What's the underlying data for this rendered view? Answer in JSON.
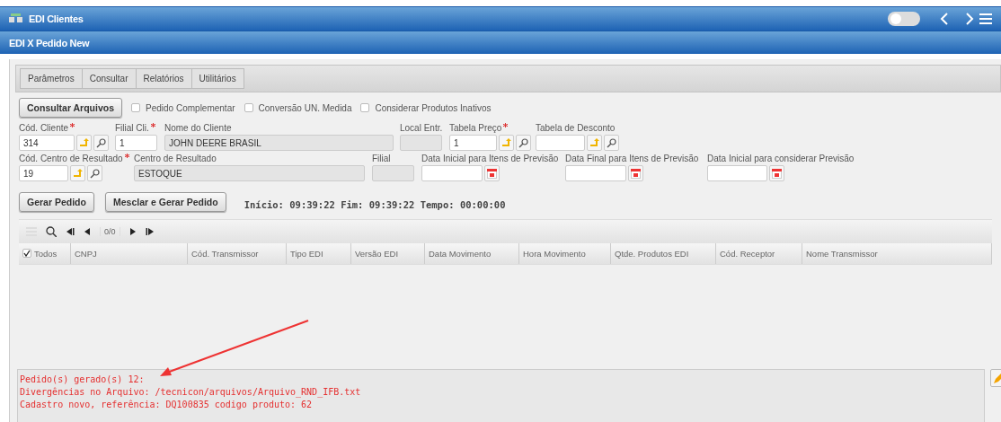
{
  "window": {
    "title": "EDI Clientes",
    "toggle_on": false
  },
  "subtitle": "EDI X Pedido New",
  "tabs": [
    {
      "label": "Parâmetros",
      "selected": false
    },
    {
      "label": "Consultar",
      "selected": false
    },
    {
      "label": "Relatórios",
      "selected": false
    },
    {
      "label": "Utilitários",
      "selected": false
    }
  ],
  "consult_button": "Consultar Arquivos",
  "options": [
    {
      "label": "Pedido Complementar",
      "checked": false
    },
    {
      "label": "Conversão UN. Medida",
      "checked": false
    },
    {
      "label": "Considerar Produtos Inativos",
      "checked": false
    }
  ],
  "field_rows": [
    [
      {
        "label": "Cód. Cliente",
        "required": true,
        "value": "314",
        "kind": "lookup",
        "readonly": false
      },
      {
        "label": "Filial Cli.",
        "required": true,
        "value": "1",
        "kind": "text",
        "readonly": false
      },
      {
        "label": "Nome do Cliente",
        "required": false,
        "value": "JOHN DEERE BRASIL",
        "kind": "text",
        "readonly": true
      },
      {
        "label": "Local Entr.",
        "required": false,
        "kind": "text",
        "readonly": true
      },
      {
        "label": "Tabela Preço",
        "required": true,
        "value": "1",
        "kind": "lookup",
        "readonly": false
      },
      {
        "label": "Tabela de Desconto",
        "required": false,
        "kind": "lookup",
        "readonly": false
      }
    ],
    [
      {
        "label": "Cód. Centro de Resultado",
        "required": true,
        "value": "19",
        "kind": "lookup",
        "readonly": false
      },
      {
        "label": "Centro de Resultado",
        "required": false,
        "value": "ESTOQUE",
        "kind": "text",
        "readonly": true
      },
      {
        "label": "Filial",
        "required": false,
        "kind": "text",
        "readonly": true
      },
      {
        "label": "Data Inicial para Itens de Previsão",
        "required": false,
        "kind": "date",
        "readonly": false
      },
      {
        "label": "Data Final para Itens de Previsão",
        "required": false,
        "kind": "date",
        "readonly": false
      },
      {
        "label": "Data Inicial para considerar Previsão",
        "required": false,
        "kind": "date",
        "readonly": false
      }
    ]
  ],
  "action_buttons": [
    "Gerar Pedido",
    "Mesclar e Gerar Pedido"
  ],
  "timing": "Início: 09:39:22 Fim: 09:39:22 Tempo: 00:00:00",
  "pager": "0/0",
  "table": {
    "select_all": {
      "label": "Todos",
      "checked": true
    },
    "columns": [
      "CNPJ",
      "Cód. Transmissor",
      "Tipo EDI",
      "Versão EDI",
      "Data Movimento",
      "Hora Movimento",
      "Qtde. Produtos EDI",
      "Cód. Receptor",
      "Nome Transmissor"
    ]
  },
  "log_lines": [
    "Pedido(s) gerado(s) 12:",
    "Divergências no Arquivo: /tecnicon/arquivos/Arquivo_RND_IFB.txt",
    "Cadastro novo, referência: DQ100835 codigo produto: 62"
  ]
}
